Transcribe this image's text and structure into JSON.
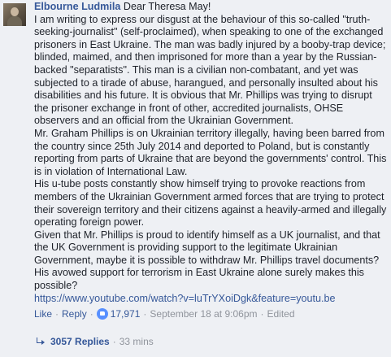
{
  "comment": {
    "author": "Elbourne Ludmila",
    "greeting": "Dear Theresa May!",
    "paragraphs": [
      "I am writing to express our disgust at the behaviour of this so-called \"truth-seeking-journalist\" (self-proclaimed), when speaking to one of the exchanged prisoners in East Ukraine. The man was badly injured by a booby-trap device; blinded, maimed, and then imprisoned for more than a year by the Russian-backed \"separatists\". This man is a civilian non-combatant, and yet was subjected to a tirade of abuse, harangued, and personally insulted about his disabilities and his future. It is obvious that Mr. Phillips was trying to disrupt the prisoner exchange in front of other, accredited journalists, OHSE observers and an official from the Ukrainian Government.",
      "Mr. Graham Phillips is on Ukrainian territory illegally, having been barred from the country since 25th July 2014 and deported to Poland, but is constantly reporting from parts of Ukraine that are beyond the governments' control. This is in violation of International Law.",
      "His u-tube posts constantly show himself trying to provoke reactions from members of the Ukrainian Government armed forces that are trying to protect their sovereign territory and their citizens against a heavily-armed and illegally operating foreign power.",
      "Given that Mr. Phillips is proud to identify himself as a UK journalist, and that the UK Government is providing support to the legitimate Ukrainian Government, maybe it is possible to withdraw Mr. Phillips travel documents? His avowed support for terrorism in East Ukraine alone surely makes this possible?"
    ],
    "link": "https://www.youtube.com/watch?v=luTrYXoiDgk&feature=youtu.be"
  },
  "actions": {
    "like": "Like",
    "dot": "·",
    "reply": "Reply",
    "reaction_count": "17,971",
    "timestamp": "September 18 at 9:06pm",
    "edited": "Edited"
  },
  "replies": {
    "count": "3057 Replies",
    "time": "33 mins"
  },
  "colors": {
    "background": "#eef0f4",
    "link": "#365899",
    "meta": "#90949c",
    "reaction": "#5890ff"
  },
  "icons": {
    "reaction": "like-thumb-icon",
    "replies": "reply-arrow-icon"
  }
}
